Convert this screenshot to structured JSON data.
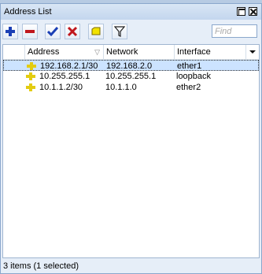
{
  "window": {
    "title": "Address List"
  },
  "toolbar": {
    "buttons": [
      {
        "name": "add-button",
        "icon": "plus-icon"
      },
      {
        "name": "remove-button",
        "icon": "minus-icon"
      },
      {
        "name": "enable-button",
        "icon": "checkmark-icon"
      },
      {
        "name": "disable-button",
        "icon": "x-icon"
      },
      {
        "name": "comment-button",
        "icon": "comment-icon"
      },
      {
        "name": "filter-button",
        "icon": "filter-icon"
      }
    ],
    "find_placeholder": "Find"
  },
  "table": {
    "columns": [
      "Address",
      "Network",
      "Interface"
    ],
    "rows": [
      {
        "address": "192.168.2.1/30",
        "network": "192.168.2.0",
        "interface": "ether1",
        "selected": true
      },
      {
        "address": "10.255.255.1",
        "network": "10.255.255.1",
        "interface": "loopback",
        "selected": false
      },
      {
        "address": "10.1.1.2/30",
        "network": "10.1.1.0",
        "interface": "ether2",
        "selected": false
      }
    ]
  },
  "status": "3 items (1 selected)",
  "colors": {
    "selected_row": "#cce3ff",
    "add": "#1a3fb5",
    "remove": "#c0171d",
    "enable": "#1a3fb5",
    "disable": "#c0171d",
    "comment": "#f2e200"
  }
}
